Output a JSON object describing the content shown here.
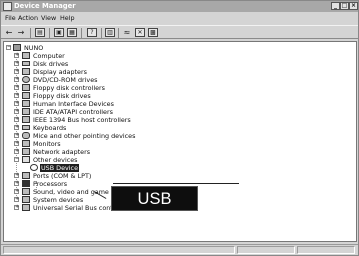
{
  "window": {
    "title": "Device Manager",
    "controls": {
      "minimize": "_",
      "restore": "□",
      "close": "×"
    }
  },
  "menu": [
    "File",
    "Action",
    "View",
    "Help"
  ],
  "toolbar_icons": [
    "back-arrow-icon",
    "forward-arrow-icon",
    "properties-icon",
    "computer-icon",
    "refresh-icon",
    "help-icon",
    "show-hidden-icon",
    "scan-hardware-icon",
    "disable-device-icon",
    "uninstall-device-icon"
  ],
  "tree": {
    "root": "NUNO",
    "items": [
      "Computer",
      "Disk drives",
      "Display adapters",
      "DVD/CD-ROM drives",
      "Floppy disk controllers",
      "Floppy disk drives",
      "Human Interface Devices",
      "IDE ATA/ATAPI controllers",
      "IEEE 1394 Bus host controllers",
      "Keyboards",
      "Mice and other pointing devices",
      "Monitors",
      "Network adapters",
      "Other devices",
      "USB Device",
      "Ports (COM & LPT)",
      "Processors",
      "Sound, video and game controllers",
      "System devices",
      "Universal Serial Bus controllers"
    ]
  },
  "callout": {
    "text": "USB Device"
  },
  "colors": {
    "title_bar": "#a8a8a8",
    "selection": "#1f1f1f",
    "callout_bg": "#0e0e0e"
  }
}
